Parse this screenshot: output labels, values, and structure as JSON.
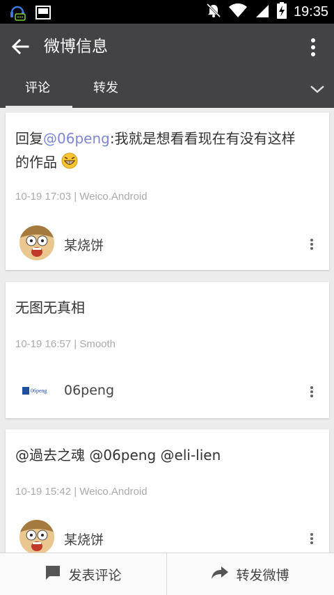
{
  "status_bar": {
    "time": "19:35",
    "icons": [
      "notification-headset-icon",
      "screenshot-icon",
      "mute-icon",
      "wifi-icon",
      "signal-icon",
      "battery-charging-icon"
    ]
  },
  "app_bar": {
    "title": "微博信息",
    "back_icon": "arrow-left-icon",
    "more_icon": "more-vert-icon"
  },
  "tabs": [
    {
      "label": "评论",
      "active": true
    },
    {
      "label": "转发",
      "active": false
    }
  ],
  "comments": [
    {
      "prefix": "回复",
      "mention": "@06peng",
      "body_line1": ":我就是想看看现在有没有这样",
      "body_line2": "的作品",
      "emoji": "grin-emoji",
      "time": "10-19 17:03",
      "source": "Weico.Android",
      "user": "某烧饼"
    },
    {
      "body": "无图无真相",
      "time": "10-19 16:57",
      "source": "Smooth",
      "user": "06peng",
      "avatar_text": "06peng"
    },
    {
      "mentions": "@過去之魂 @06peng @eli-lien",
      "time": "10-19 15:42",
      "source": "Weico.Android",
      "user": "某烧饼"
    }
  ],
  "bottom_bar": {
    "comment_label": "发表评论",
    "repost_label": "转发微博"
  },
  "colors": {
    "app_bar": "#434346",
    "mention": "#7f87d6",
    "background": "#ececec"
  }
}
